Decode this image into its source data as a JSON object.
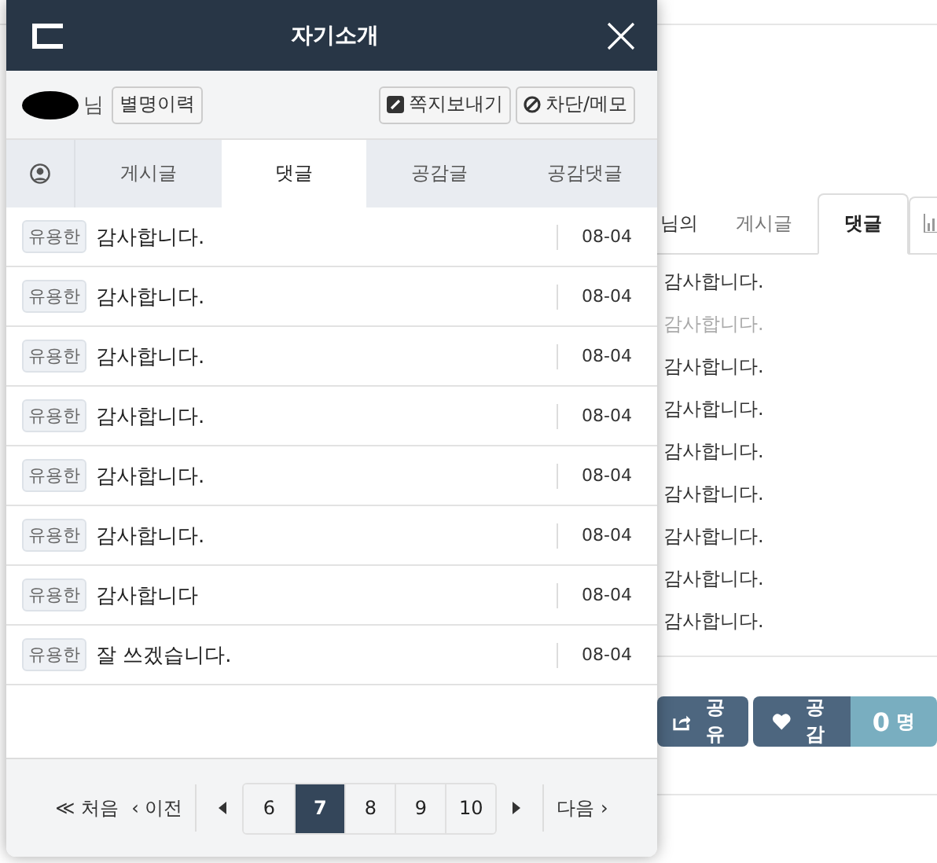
{
  "page": {
    "tabs_prefix": "님의",
    "tabs": [
      {
        "label": "게시글",
        "selected": false
      },
      {
        "label": "댓글",
        "selected": true
      },
      {
        "kind": "chart-icon",
        "selected": false
      }
    ],
    "comments": [
      {
        "text": "감사합니다.",
        "dimmed": false
      },
      {
        "text": "감사합니다.",
        "dimmed": true
      },
      {
        "text": "감사합니다.",
        "dimmed": false
      },
      {
        "text": "감사합니다.",
        "dimmed": false
      },
      {
        "text": "감사합니다.",
        "dimmed": false
      },
      {
        "text": "감사합니다.",
        "dimmed": false
      },
      {
        "text": "감사합니다.",
        "dimmed": false
      },
      {
        "text": "감사합니다.",
        "dimmed": false
      },
      {
        "text": "감사합니다.",
        "dimmed": false
      }
    ],
    "share_button": "공유",
    "like_button": "공감",
    "like_count": "0",
    "like_unit": "명"
  },
  "modal": {
    "title": "자기소개",
    "user_suffix": "님",
    "nickname_history_button": "별명이력",
    "actions": [
      {
        "kind": "message",
        "label": "쪽지보내기"
      },
      {
        "kind": "block",
        "label": "차단/메모"
      }
    ],
    "tabs": [
      {
        "kind": "profile-icon",
        "selected": false
      },
      {
        "label": "게시글",
        "selected": false
      },
      {
        "label": "댓글",
        "selected": true
      },
      {
        "label": "공감글",
        "selected": false
      },
      {
        "label": "공감댓글",
        "selected": false
      }
    ],
    "rows": [
      {
        "tag": "유용한",
        "text": "감사합니다.",
        "date": "08-04"
      },
      {
        "tag": "유용한",
        "text": "감사합니다.",
        "date": "08-04"
      },
      {
        "tag": "유용한",
        "text": "감사합니다.",
        "date": "08-04"
      },
      {
        "tag": "유용한",
        "text": "감사합니다.",
        "date": "08-04"
      },
      {
        "tag": "유용한",
        "text": "감사합니다.",
        "date": "08-04"
      },
      {
        "tag": "유용한",
        "text": "감사합니다.",
        "date": "08-04"
      },
      {
        "tag": "유용한",
        "text": "감사합니다",
        "date": "08-04"
      },
      {
        "tag": "유용한",
        "text": "잘 쓰겠습니다.",
        "date": "08-04"
      }
    ],
    "pagination": {
      "first": "≪ 처음",
      "prev": "‹ 이전",
      "next": "다음 ›",
      "pages": [
        {
          "label": "6",
          "selected": false
        },
        {
          "label": "7",
          "selected": true
        },
        {
          "label": "8",
          "selected": false
        },
        {
          "label": "9",
          "selected": false
        },
        {
          "label": "10",
          "selected": false
        }
      ]
    }
  }
}
